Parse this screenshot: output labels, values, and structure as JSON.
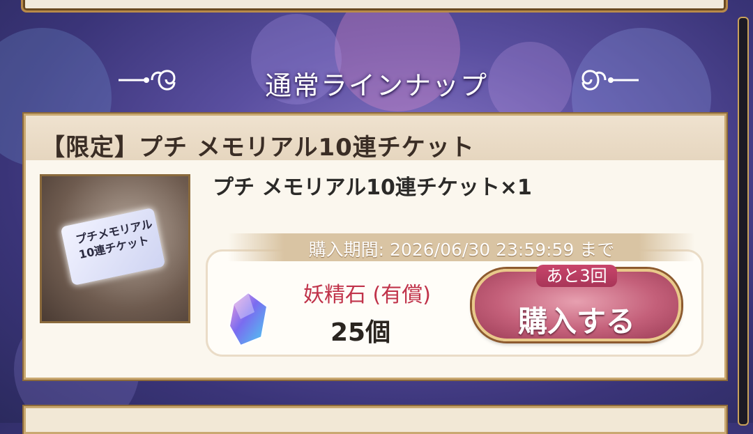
{
  "section": {
    "title": "通常ラインナップ"
  },
  "product": {
    "title": "【限定】プチ メモリアル10連チケット",
    "thumbnail_text_line1": "プチメモリアル",
    "thumbnail_text_line2": "10連チケット",
    "item_name": "プチ メモリアル10連チケット×1",
    "purchase_period": "購入期間: 2026/06/30 23:59:59 まで",
    "currency_name": "妖精石 (有償)",
    "price": "25個",
    "remaining": "あと3回",
    "buy_label": "購入する"
  },
  "colors": {
    "accent_pink": "#c4607a",
    "gold_border": "#c9a870",
    "currency_red": "#c0334a"
  },
  "icons": [
    "ornament-left-icon",
    "ornament-right-icon",
    "gem-icon",
    "ticket-icon"
  ]
}
